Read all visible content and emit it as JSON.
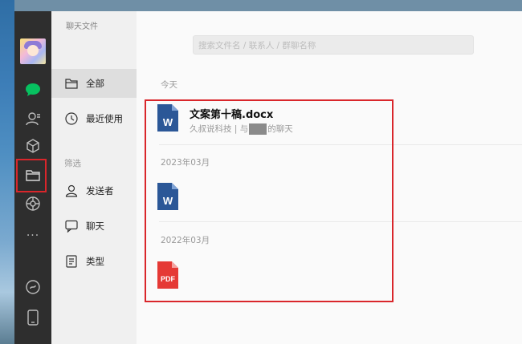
{
  "window": {
    "title": "聊天文件"
  },
  "search": {
    "placeholder": "搜索文件名 / 联系人 / 群聊名称"
  },
  "nav": {
    "icons": [
      "chat-icon",
      "contacts-icon",
      "cube-icon",
      "folder-icon",
      "moments-icon",
      "more-icon",
      "mini-program-icon",
      "phone-icon"
    ],
    "more_label": "···"
  },
  "panel": {
    "items": [
      {
        "label": "全部",
        "icon": "folder-icon"
      },
      {
        "label": "最近使用",
        "icon": "clock-icon"
      }
    ],
    "filter_label": "筛选",
    "filters": [
      {
        "label": "发送者",
        "icon": "person-icon"
      },
      {
        "label": "聊天",
        "icon": "chat-bubble-icon"
      },
      {
        "label": "类型",
        "icon": "document-icon"
      }
    ]
  },
  "main": {
    "groups": [
      {
        "date": "今天",
        "file_name": "文案第十稿.docx",
        "meta_prefix": "久叔说科技 | 与",
        "meta_suffix": "的聊天",
        "type": "W"
      },
      {
        "date": "2023年03月",
        "type": "W"
      },
      {
        "date": "2022年03月",
        "type": "PDF"
      }
    ]
  },
  "colors": {
    "nav_bg": "#2e2e2e",
    "accent_green": "#07c160",
    "word_blue": "#2b5797",
    "pdf_red": "#e53935",
    "highlight_red": "#d9262b"
  }
}
